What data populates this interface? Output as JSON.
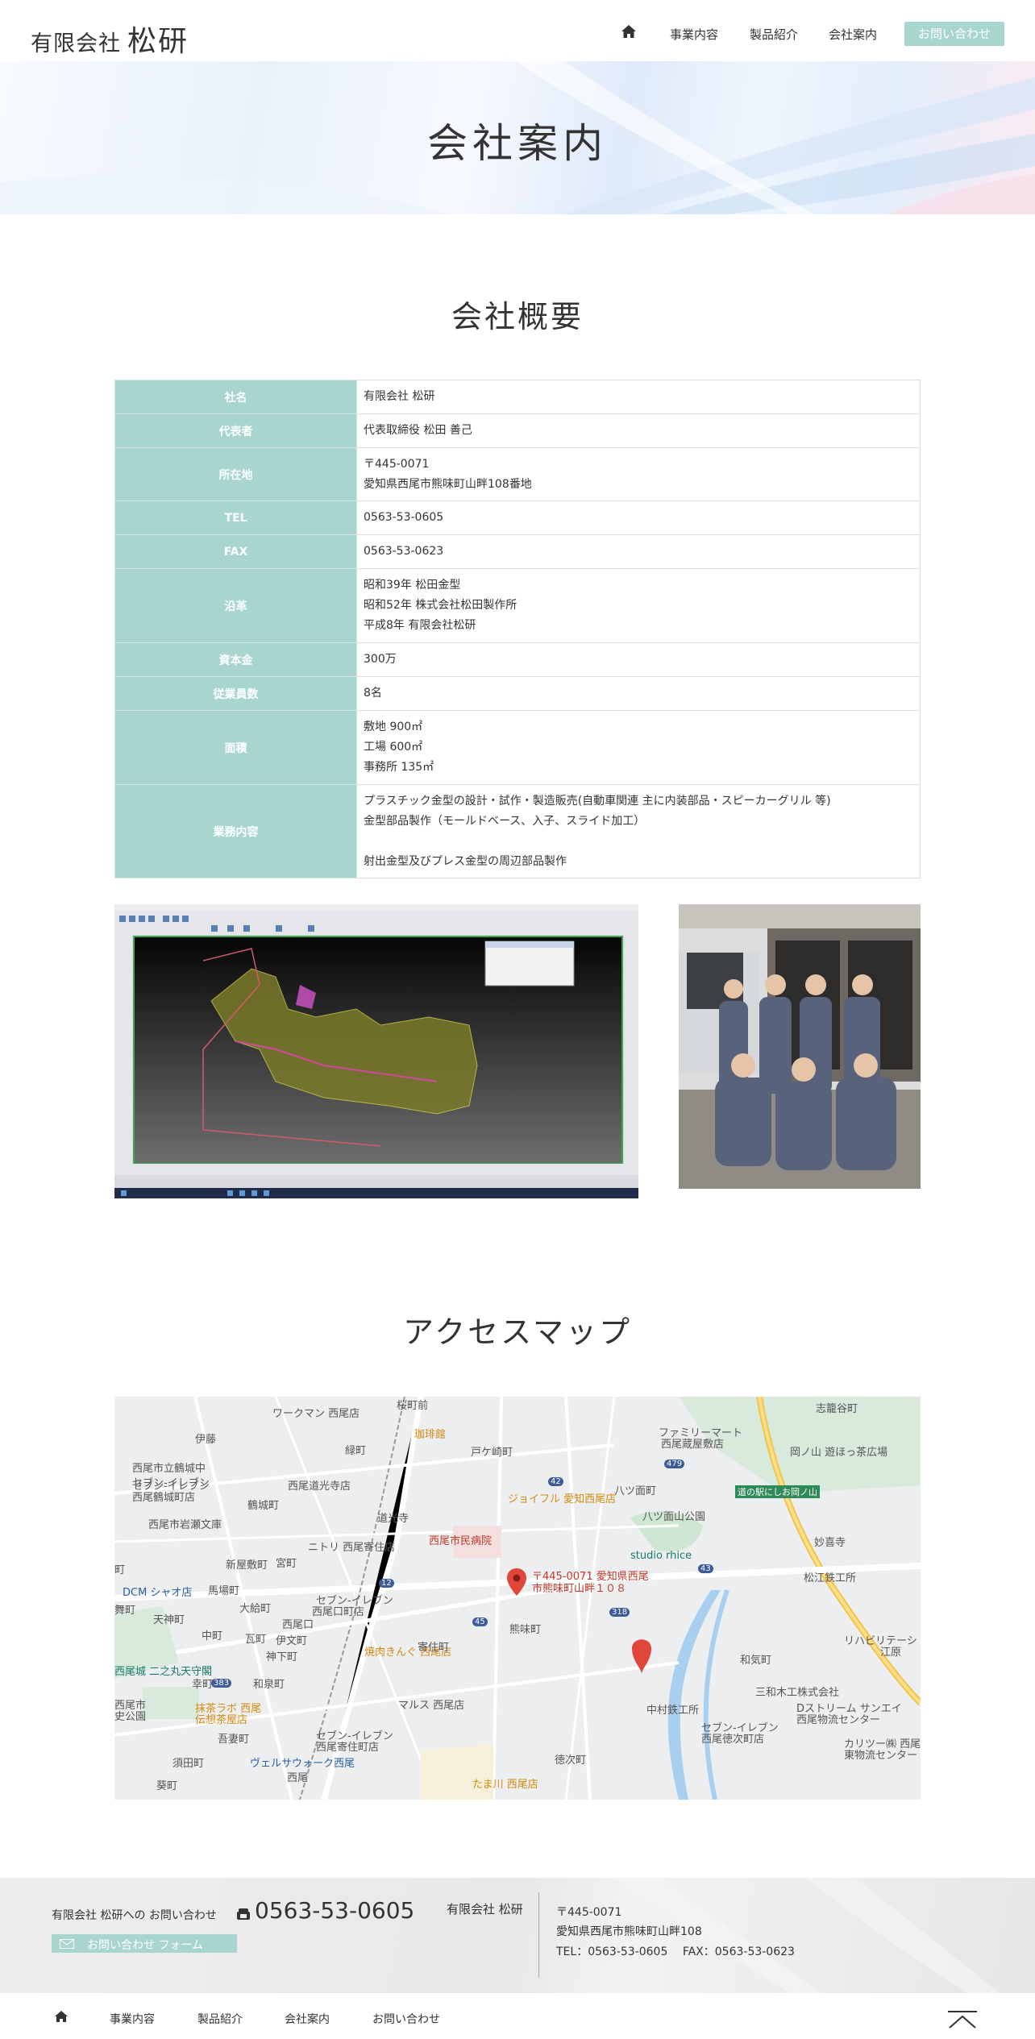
{
  "header": {
    "logo_small": "有限会社",
    "logo_big": "松研",
    "nav": [
      "事業内容",
      "製品紹介",
      "会社案内"
    ],
    "contact_button": "お問い合わせ"
  },
  "hero": {
    "title": "会社案内"
  },
  "overview": {
    "title": "会社概要",
    "rows": [
      {
        "label": "社名",
        "lines": [
          "有限会社 松研"
        ]
      },
      {
        "label": "代表者",
        "lines": [
          "代表取締役 松田 善己"
        ]
      },
      {
        "label": "所在地",
        "lines": [
          "〒445-0071",
          "愛知県西尾市熊味町山畔108番地"
        ]
      },
      {
        "label": "TEL",
        "lines": [
          "0563-53-0605"
        ]
      },
      {
        "label": "FAX",
        "lines": [
          "0563-53-0623"
        ]
      },
      {
        "label": "沿革",
        "lines": [
          "昭和39年 松田金型",
          "昭和52年 株式会社松田製作所",
          "平成8年 有限会社松研"
        ]
      },
      {
        "label": "資本金",
        "lines": [
          "300万"
        ]
      },
      {
        "label": "従業員数",
        "lines": [
          "8名"
        ]
      },
      {
        "label": "面積",
        "lines": [
          "敷地 900㎡",
          "工場 600㎡",
          "事務所 135㎡"
        ]
      },
      {
        "label": "業務内容",
        "lines": [
          "プラスチック金型の設計・試作・製造販売(自動車関連 主に内装部品・スピーカーグリル 等)",
          "金型部品製作（モールドベース、入子、スライド加工）",
          "",
          "射出金型及びプレス金型の周辺部品製作"
        ]
      }
    ]
  },
  "access": {
    "title": "アクセスマップ",
    "map": {
      "marker_text_1": "〒445-0071 愛知県西尾",
      "marker_text_2": "市熊味町山畔１０８",
      "labels": [
        "桜町前",
        "志籠谷町",
        "ワークマン 西尾店",
        "珈琲館",
        "ファミリーマート",
        "西尾蔵屋敷店",
        "伊藤",
        "緑町",
        "戸ケ崎町",
        "岡ノ山 遊ほっ茶広場",
        "西尾市立鶴城中",
        "セブン-イレブン",
        "西尾道光寺店",
        "479",
        "道の駅にしお岡ノ山",
        "セブン-イレブン",
        "西尾鶴城町店",
        "鶴城町",
        "ジョイフル 愛知西尾店",
        "八ツ面町",
        "八ツ面山公園",
        "西尾市岩瀬文庫",
        "道光寺",
        "ニトリ 西尾寄住店",
        "西尾市民病院",
        "妙喜寺",
        "新屋敷町",
        "宮町",
        "studio rhice",
        "馬場町",
        "松江鉄工所",
        "大給町",
        "セブン-イレブン",
        "西尾口町店",
        "天神町",
        "西尾口",
        "熊味町",
        "中町",
        "瓦町",
        "伊文町",
        "焼肉きんぐ 西尾店",
        "寄住町",
        "リハビリテーシ",
        "神下町",
        "和気町",
        "江原",
        "西尾城 二之丸天守閣",
        "幸町",
        "和泉町",
        "三和木工株式会社",
        "抹茶ラボ 西尾",
        "伝想茶屋店",
        "マルス 西尾店",
        "中村鉄工所",
        "Dストリーム サンエイ",
        "西尾物流センター",
        "吾妻町",
        "セブン-イレブン",
        "西尾徳次町店",
        "セブン-イレブン",
        "西尾寄住町店",
        "カリツー㈱ 西尾",
        "東物流センター",
        "須田町",
        "ヴェルサウォーク西尾",
        "徳次町",
        "西尾",
        "葵町",
        "たま川 西尾店",
        "DCM シャオ店",
        "舞町",
        "西尾市",
        "史公園",
        "町",
        "45",
        "318",
        "43",
        "42",
        "383",
        "12"
      ]
    }
  },
  "footer": {
    "contact_label": "有限会社 松研への お問い合わせ",
    "phone": "0563-53-0605",
    "form_button": "お問い合わせ フォーム",
    "company": "有限会社 松研",
    "postal": "〒445-0071",
    "address": "愛知県西尾市熊味町山畔108",
    "tel_fax": "TEL：0563-53-0605　 FAX：0563-53-0623",
    "nav": [
      "事業内容",
      "製品紹介",
      "会社案内",
      "お問い合わせ"
    ]
  }
}
